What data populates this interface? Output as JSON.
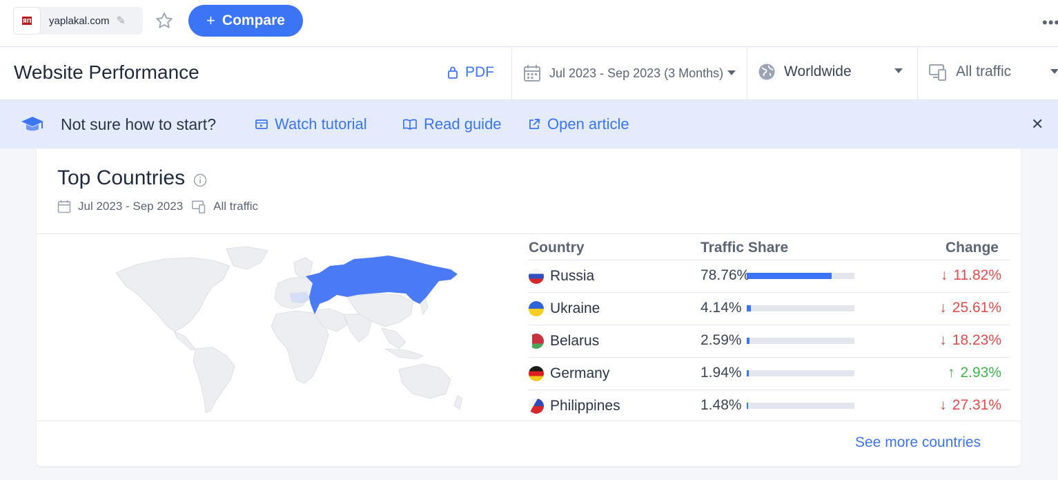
{
  "topbar": {
    "site_name": "yaplakal.com",
    "favicon_text": "ЯП",
    "compare_label": "Compare"
  },
  "header": {
    "title": "Website Performance",
    "pdf_label": "PDF",
    "date_range": "Jul 2023 - Sep 2023 (3 Months)",
    "geo": "Worldwide",
    "traffic": "All traffic"
  },
  "banner": {
    "question": "Not sure how to start?",
    "watch_tutorial": "Watch tutorial",
    "read_guide": "Read guide",
    "open_article": "Open article"
  },
  "card": {
    "title": "Top Countries",
    "date_range": "Jul 2023 - Sep 2023",
    "traffic": "All traffic",
    "see_more": "See more countries"
  },
  "table": {
    "headers": {
      "country": "Country",
      "share": "Traffic Share",
      "change": "Change"
    },
    "rows": [
      {
        "country": "Russia",
        "share_text": "78.76%",
        "share": 0.7876,
        "change_text": "11.82%",
        "direction": "down"
      },
      {
        "country": "Ukraine",
        "share_text": "4.14%",
        "share": 0.0414,
        "change_text": "25.61%",
        "direction": "down"
      },
      {
        "country": "Belarus",
        "share_text": "2.59%",
        "share": 0.0259,
        "change_text": "18.23%",
        "direction": "down"
      },
      {
        "country": "Germany",
        "share_text": "1.94%",
        "share": 0.0194,
        "change_text": "2.93%",
        "direction": "up"
      },
      {
        "country": "Philippines",
        "share_text": "1.48%",
        "share": 0.0148,
        "change_text": "27.31%",
        "direction": "down"
      }
    ]
  },
  "colors": {
    "accent": "#3b74f4",
    "negative": "#e04b4b",
    "positive": "#3fb54b",
    "banner_bg": "#e3ebfc"
  }
}
